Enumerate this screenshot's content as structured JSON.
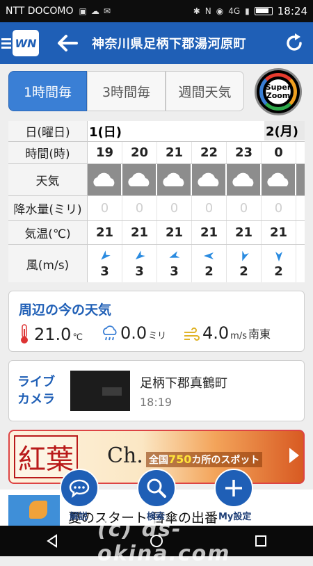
{
  "status_bar": {
    "carrier": "NTT DOCOMO",
    "signal_text": "4G",
    "time": "18:24"
  },
  "header": {
    "logo_text": "WN",
    "title": "神奈川県足柄下郡湯河原町"
  },
  "tabs": [
    {
      "label": "1時間毎",
      "active": true
    },
    {
      "label": "3時間毎",
      "active": false
    },
    {
      "label": "週間天気",
      "active": false
    }
  ],
  "super_zoom": {
    "line1": "Super",
    "line2": "Zoom"
  },
  "forecast": {
    "row_labels": {
      "day": "日(曜日)",
      "hour": "時間(時)",
      "weather": "天気",
      "precip": "降水量(ミリ)",
      "temp": "気温(℃)",
      "wind": "風(m/s)"
    },
    "days": [
      {
        "label": "1(日)"
      },
      {
        "label": "2(月)"
      }
    ],
    "hours": [
      "19",
      "20",
      "21",
      "22",
      "23",
      "0"
    ],
    "weather": [
      "cloudy",
      "cloudy",
      "cloudy",
      "cloudy",
      "cloudy",
      "cloudy"
    ],
    "precip": [
      "0",
      "0",
      "0",
      "0",
      "0",
      "0"
    ],
    "temp": [
      "21",
      "21",
      "21",
      "21",
      "21",
      "21"
    ],
    "wind_speed": [
      "3",
      "3",
      "3",
      "2",
      "2",
      "2"
    ],
    "wind_arrow_rotation_deg": [
      225,
      230,
      250,
      270,
      200,
      180
    ]
  },
  "current": {
    "title": "周辺の今の天気",
    "temp": "21.0",
    "temp_unit": "℃",
    "rain": "0.0",
    "rain_unit": "ミリ",
    "wind": "4.0",
    "wind_unit": "m/s",
    "wind_dir": "南東"
  },
  "live_camera": {
    "label_line1": "ライブ",
    "label_line2": "カメラ",
    "place": "足柄下郡真鶴町",
    "time": "18:19"
  },
  "banner": {
    "text1": "紅葉",
    "text2": "Ch.",
    "text3_pre": "全国",
    "text3_num": "750",
    "text3_post": "カ所のスポット"
  },
  "bottom": {
    "ad_text": "夏のスタート 日傘の出番",
    "fab_labels": [
      "解説",
      "検索",
      "My設定"
    ]
  },
  "watermark": "(c) ds-okina.com"
}
